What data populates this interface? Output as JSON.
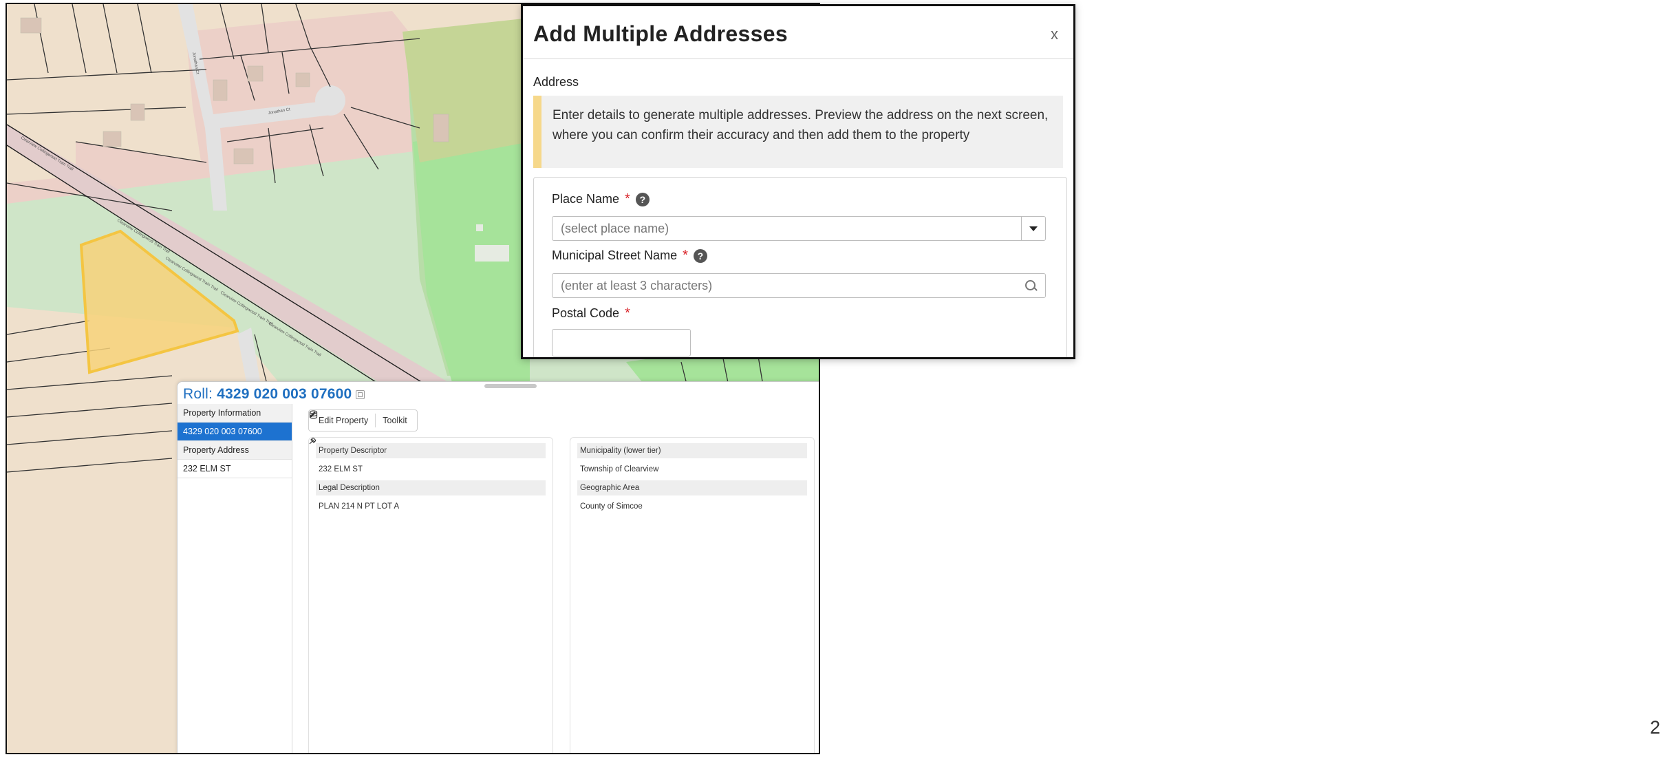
{
  "map": {
    "street_labels": [
      "Jonathan Ct",
      "Jonathan Ct"
    ],
    "trail_labels": [
      "Clearview Collingwood Train Trail",
      "Clearview Collingwood Train Trail",
      "Clearview Collingwood Train Trail",
      "Clearview Collingwood Train Trail",
      "Clearview Collingwood Train Trail"
    ]
  },
  "modal": {
    "title": "Add Multiple Addresses",
    "close_label": "x",
    "section_title": "Address",
    "info_text": "Enter details to generate multiple addresses. Preview the address on the next screen, where you can confirm their accuracy and then add them to the property",
    "fields": {
      "place_name": {
        "label": "Place Name",
        "required_mark": "*",
        "help": "?",
        "value": "(select place name)"
      },
      "street_name": {
        "label": "Municipal Street Name",
        "required_mark": "*",
        "help": "?",
        "placeholder": "(enter at least 3 characters)"
      },
      "postal_code": {
        "label": "Postal Code",
        "required_mark": "*",
        "value": ""
      }
    }
  },
  "roll_panel": {
    "title_prefix": "Roll:",
    "roll_number": "4329 020 003 07600",
    "nav": [
      {
        "label": "Property Information",
        "kind": "header"
      },
      {
        "label": "4329 020 003 07600",
        "kind": "selected"
      },
      {
        "label": "Property Address",
        "kind": "header"
      },
      {
        "label": "232 ELM ST",
        "kind": "item"
      }
    ],
    "toolbar": {
      "edit_label": "Edit Property",
      "toolkit_label": "Toolkit"
    },
    "left_card": {
      "rows": [
        {
          "label": "Property Descriptor",
          "value": "232 ELM ST"
        },
        {
          "label": "Legal Description",
          "value": "PLAN 214 N PT LOT A"
        }
      ]
    },
    "right_card": {
      "rows": [
        {
          "label": "Municipality (lower tier)",
          "value": "Township of Clearview"
        },
        {
          "label": "Geographic Area",
          "value": "County of Simcoe"
        }
      ]
    }
  },
  "page_number": "2",
  "colors": {
    "accent_blue": "#1d72d0",
    "required_red": "#d9242a",
    "info_stripe": "#f6d88a",
    "parcel_highlight": "#f7d27a",
    "residential_pink": "#ecd0c8",
    "park_green": "#a6e39a"
  }
}
